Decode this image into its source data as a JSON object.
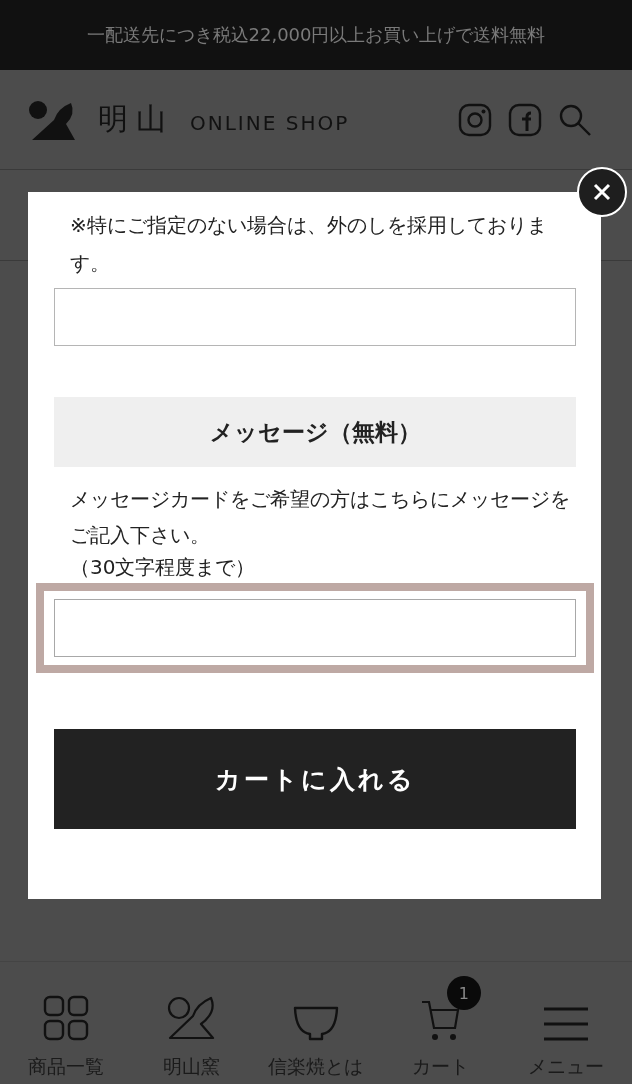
{
  "banner": {
    "text": "一配送先につき税込22,000円以上お買い上げで送料無料"
  },
  "header": {
    "logo_mark": "明山",
    "logo_text": "ONLINE SHOP"
  },
  "modal": {
    "note": "※特にご指定のない場合は、外のしを採用しております。",
    "message_heading": "メッセージ（無料）",
    "message_help": "メッセージカードをご希望の方はこちらにメッセージをご記入下さい。",
    "message_limit": "（30文字程度まで）",
    "message_field_focused": true,
    "submit": "カートに入れる"
  },
  "bottom_nav": [
    {
      "kind": "grid",
      "label": "商品一覧"
    },
    {
      "kind": "logo",
      "label": "明山窯"
    },
    {
      "kind": "bowl",
      "label": "信楽焼とは"
    },
    {
      "kind": "cart",
      "label": "カート",
      "badge": "1"
    },
    {
      "kind": "menu",
      "label": "メニュー"
    }
  ]
}
